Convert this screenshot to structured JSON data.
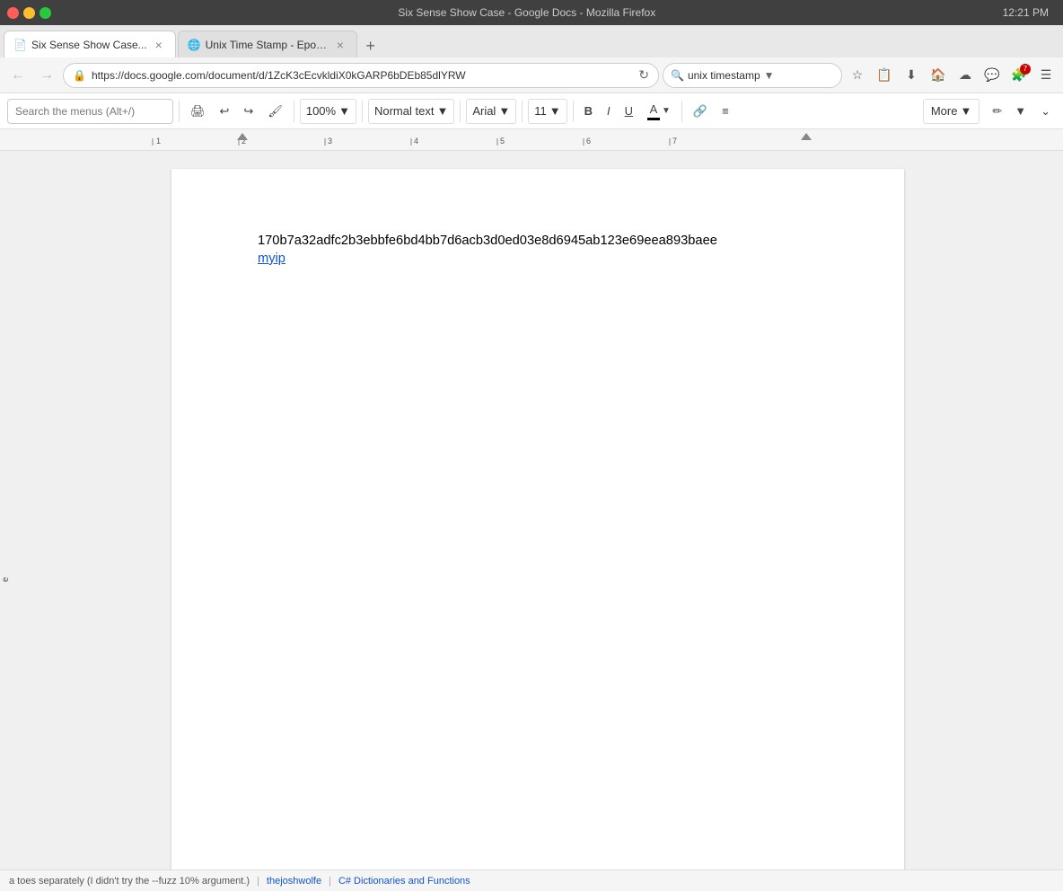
{
  "titlebar": {
    "title": "Six Sense Show Case - Google Docs - Mozilla Firefox",
    "time": "12:21 PM"
  },
  "tabs": [
    {
      "id": "tab1",
      "label": "Six Sense Show Case...",
      "icon": "📄",
      "active": true,
      "closeable": true
    },
    {
      "id": "tab2",
      "label": "Unix Time Stamp - Epoc...",
      "icon": "🌐",
      "active": false,
      "closeable": true
    }
  ],
  "navbar": {
    "address": "https://docs.google.com/document/d/1ZcK3cEcvkldiX0kGARP6bDEb85dlYRW",
    "search_value": "unix timestamp"
  },
  "toolbar": {
    "search_placeholder": "Search the menus (Alt+/)",
    "zoom": "100%",
    "style": "Normal text",
    "font": "Arial",
    "font_size": "11",
    "bold_label": "B",
    "italic_label": "I",
    "underline_label": "U",
    "more_label": "More",
    "link_label": "🔗",
    "align_label": "≡"
  },
  "document": {
    "line1": "170b7a32adfc2b3ebbfe6bd4bb7d6acb3d0ed03e8d6945ab123e69eea893baee",
    "line2": "myip"
  },
  "bottom_bar": {
    "items": [
      "a  toes separately (I didn't try the --fuzz 10% argument.)",
      "thejoshwolfe",
      "C# Dictionaries and Functions"
    ]
  }
}
